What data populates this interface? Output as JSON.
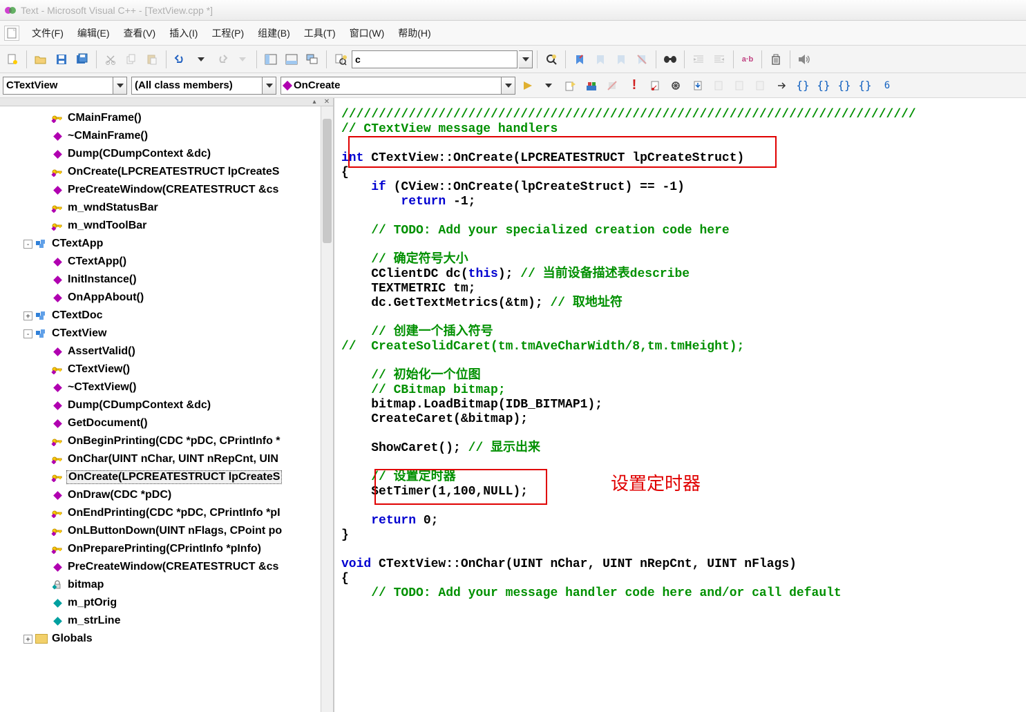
{
  "title": "Text - Microsoft Visual C++ - [TextView.cpp *]",
  "menu": {
    "file": "文件(F)",
    "edit": "编辑(E)",
    "view": "查看(V)",
    "insert": "插入(I)",
    "project": "工程(P)",
    "build": "组建(B)",
    "tools": "工具(T)",
    "window": "窗口(W)",
    "help": "帮助(H)"
  },
  "toolbar1": {
    "search_value": "c"
  },
  "combos": {
    "class": "CTextView",
    "filter": "(All class members)",
    "member": "OnCreate"
  },
  "tree": {
    "items": [
      {
        "depth": 3,
        "icon": "key",
        "label": "CMainFrame()"
      },
      {
        "depth": 3,
        "icon": "magenta",
        "label": "~CMainFrame()"
      },
      {
        "depth": 3,
        "icon": "magenta",
        "label": "Dump(CDumpContext &dc)"
      },
      {
        "depth": 3,
        "icon": "key",
        "label": "OnCreate(LPCREATESTRUCT lpCreateS"
      },
      {
        "depth": 3,
        "icon": "magenta",
        "label": "PreCreateWindow(CREATESTRUCT &cs"
      },
      {
        "depth": 3,
        "icon": "key",
        "label": "m_wndStatusBar"
      },
      {
        "depth": 3,
        "icon": "key",
        "label": "m_wndToolBar"
      },
      {
        "depth": 2,
        "icon": "class",
        "label": "CTextApp",
        "expander": "-"
      },
      {
        "depth": 3,
        "icon": "magenta",
        "label": "CTextApp()"
      },
      {
        "depth": 3,
        "icon": "magenta",
        "label": "InitInstance()"
      },
      {
        "depth": 3,
        "icon": "magenta",
        "label": "OnAppAbout()"
      },
      {
        "depth": 2,
        "icon": "class",
        "label": "CTextDoc",
        "expander": "+"
      },
      {
        "depth": 2,
        "icon": "class",
        "label": "CTextView",
        "expander": "-"
      },
      {
        "depth": 3,
        "icon": "magenta",
        "label": "AssertValid()"
      },
      {
        "depth": 3,
        "icon": "key",
        "label": "CTextView()"
      },
      {
        "depth": 3,
        "icon": "magenta",
        "label": "~CTextView()"
      },
      {
        "depth": 3,
        "icon": "magenta",
        "label": "Dump(CDumpContext &dc)"
      },
      {
        "depth": 3,
        "icon": "magenta",
        "label": "GetDocument()"
      },
      {
        "depth": 3,
        "icon": "key",
        "label": "OnBeginPrinting(CDC *pDC, CPrintInfo *"
      },
      {
        "depth": 3,
        "icon": "key",
        "label": "OnChar(UINT nChar, UINT nRepCnt, UIN"
      },
      {
        "depth": 3,
        "icon": "key",
        "label": "OnCreate(LPCREATESTRUCT lpCreateS",
        "selected": true
      },
      {
        "depth": 3,
        "icon": "magenta",
        "label": "OnDraw(CDC *pDC)"
      },
      {
        "depth": 3,
        "icon": "key",
        "label": "OnEndPrinting(CDC *pDC, CPrintInfo *pI"
      },
      {
        "depth": 3,
        "icon": "key",
        "label": "OnLButtonDown(UINT nFlags, CPoint po"
      },
      {
        "depth": 3,
        "icon": "key",
        "label": "OnPreparePrinting(CPrintInfo *pInfo)"
      },
      {
        "depth": 3,
        "icon": "magenta",
        "label": "PreCreateWindow(CREATESTRUCT &cs"
      },
      {
        "depth": 3,
        "icon": "lock",
        "label": "bitmap"
      },
      {
        "depth": 3,
        "icon": "teal",
        "label": "m_ptOrig"
      },
      {
        "depth": 3,
        "icon": "teal",
        "label": "m_strLine"
      },
      {
        "depth": 2,
        "icon": "folder",
        "label": "Globals",
        "expander": "+"
      }
    ]
  },
  "code": {
    "l1": "/////////////////////////////////////////////////////////////////////////////",
    "l2": "// CTextView message handlers",
    "l3a": "int",
    "l3b": " CTextView::OnCreate(LPCREATESTRUCT lpCreateStruct)",
    "l4": "{",
    "l5a": "    ",
    "l5b": "if",
    "l5c": " (CView::OnCreate(lpCreateStruct) == -1)",
    "l6a": "        ",
    "l6b": "return",
    "l6c": " -1;",
    "l7": "",
    "l8a": "    ",
    "l8b": "// TODO: Add your specialized creation code here",
    "l9": "",
    "l10a": "    ",
    "l10b": "// 确定符号大小",
    "l11a": "    CClientDC dc(",
    "l11b": "this",
    "l11c": "); ",
    "l11d": "// 当前设备描述表describe",
    "l12": "    TEXTMETRIC tm;",
    "l13a": "    dc.GetTextMetrics(&tm); ",
    "l13b": "// 取地址符",
    "l14": "",
    "l15a": "    ",
    "l15b": "// 创建一个插入符号",
    "l16": "//  CreateSolidCaret(tm.tmAveCharWidth/8,tm.tmHeight);",
    "l17": "",
    "l18a": "    ",
    "l18b": "// 初始化一个位图",
    "l19a": "    ",
    "l19b": "// CBitmap bitmap;",
    "l20": "    bitmap.LoadBitmap(IDB_BITMAP1);",
    "l21": "    CreateCaret(&bitmap);",
    "l22": "",
    "l23a": "    ShowCaret(); ",
    "l23b": "// 显示出来",
    "l24": "",
    "l25a": "    ",
    "l25b": "// 设置定时器",
    "l26": "    SetTimer(1,100,NULL);",
    "l27": "",
    "l28a": "    ",
    "l28b": "return",
    "l28c": " 0;",
    "l29": "}",
    "l30": "",
    "l31a": "void",
    "l31b": " CTextView::OnChar(UINT nChar, UINT nRepCnt, UINT nFlags)",
    "l32": "{",
    "l33a": "    ",
    "l33b": "// TODO: Add your message handler code here and/or call default"
  },
  "annotation": "设置定时器"
}
